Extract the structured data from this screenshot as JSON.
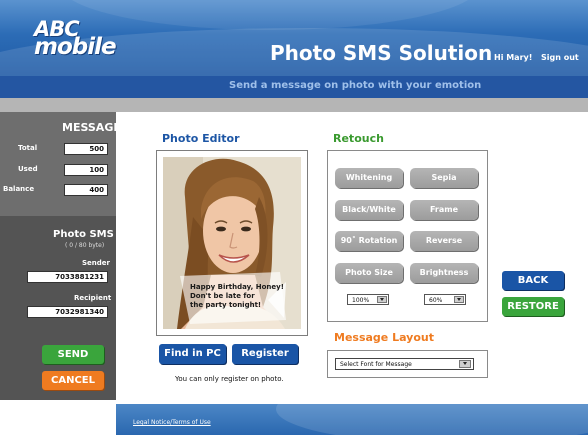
{
  "header": {
    "logo_line1": "ABC",
    "logo_line2": "mobile",
    "app_title": "Photo SMS Solution",
    "greeting": "Hi Mary!",
    "sign_out": "Sign out",
    "subtitle": "Send a message on photo with your emotion"
  },
  "message_panel": {
    "title": "MESSAGE",
    "rows": [
      {
        "label": "Total",
        "value": "500"
      },
      {
        "label": "Used",
        "value": "100"
      },
      {
        "label": "Balance",
        "value": "400"
      }
    ]
  },
  "photo_sms_panel": {
    "title": "Photo SMS",
    "byte_info": "( 0 / 80 byte)",
    "sender_label": "Sender",
    "sender_value": "7033881231",
    "recipient_label": "Recipient",
    "recipient_value": "7032981340",
    "send_label": "SEND",
    "cancel_label": "CANCEL"
  },
  "photo_editor": {
    "title": "Photo Editor",
    "message_lines": [
      "Happy Birthday, Honey!",
      "Don't be late for",
      "the party tonight!"
    ],
    "find_label": "Find in PC",
    "register_label": "Register",
    "register_note": "You can only register on photo."
  },
  "retouch": {
    "title": "Retouch",
    "buttons": [
      "Whitening",
      "Sepia",
      "Black/White",
      "Frame",
      "90˚ Rotation",
      "Reverse",
      "Photo Size",
      "Brightness"
    ],
    "photo_size_value": "100%",
    "brightness_value": "60%"
  },
  "actions": {
    "back_label": "BACK",
    "restore_label": "RESTORE"
  },
  "message_layout": {
    "title": "Message Layout",
    "font_select": "Select Font for Message"
  },
  "footer": {
    "legal": "Legal Notice/Terms of Use"
  },
  "colors": {
    "header_blue": "#2c6cb6",
    "subbar_blue": "#2456a2",
    "editor_title_blue": "#1d56a5",
    "retouch_green": "#3a9a2f",
    "layout_orange": "#ef7b20",
    "send_green": "#3aa53c",
    "cancel_orange": "#ef7b20",
    "back_blue": "#1a55a6",
    "panel_gray": "#6e6e6e",
    "retouch_button_gray": "#a8a8a8"
  }
}
